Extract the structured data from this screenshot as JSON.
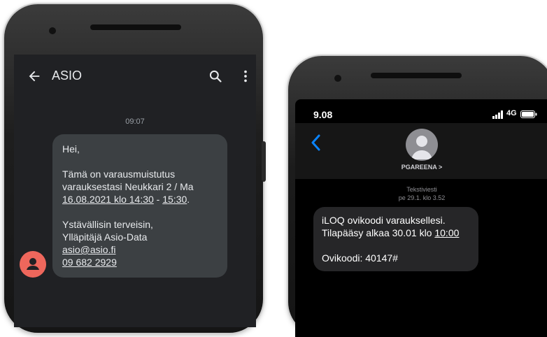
{
  "android": {
    "app_title": "ASIO",
    "time": "09:07",
    "message": {
      "greeting": "Hei,",
      "line1": "Tämä on varausmuistutus",
      "line2": "varauksestasi Neukkari 2 / Ma",
      "date_time": "16.08.2021 klo 14:30",
      "dash": " - ",
      "end_time": "15:30",
      "dot": ".",
      "closing": "Ystävällisin terveisin,",
      "sender": "Ylläpitäjä Asio-Data",
      "email": "asio@asio.fi",
      "phone": "09 682 2929"
    }
  },
  "iphone": {
    "status_time": "9.08",
    "network": "4G",
    "contact_name": "PGAREENA >",
    "message_type": "Tekstiviesti",
    "message_date": "pe 29.1. klo 3.52",
    "message": {
      "line1": "iLOQ ovikoodi varauksellesi.",
      "line2_prefix": "Tilapääsy alkaa 30.01 klo ",
      "line2_time": "10:00",
      "code_line": "Ovikoodi: 40147#"
    }
  },
  "colors": {
    "android_bg": "#202124",
    "android_bubble": "#3c4043",
    "avatar_red": "#ee675c",
    "ios_blue": "#0a84ff"
  }
}
